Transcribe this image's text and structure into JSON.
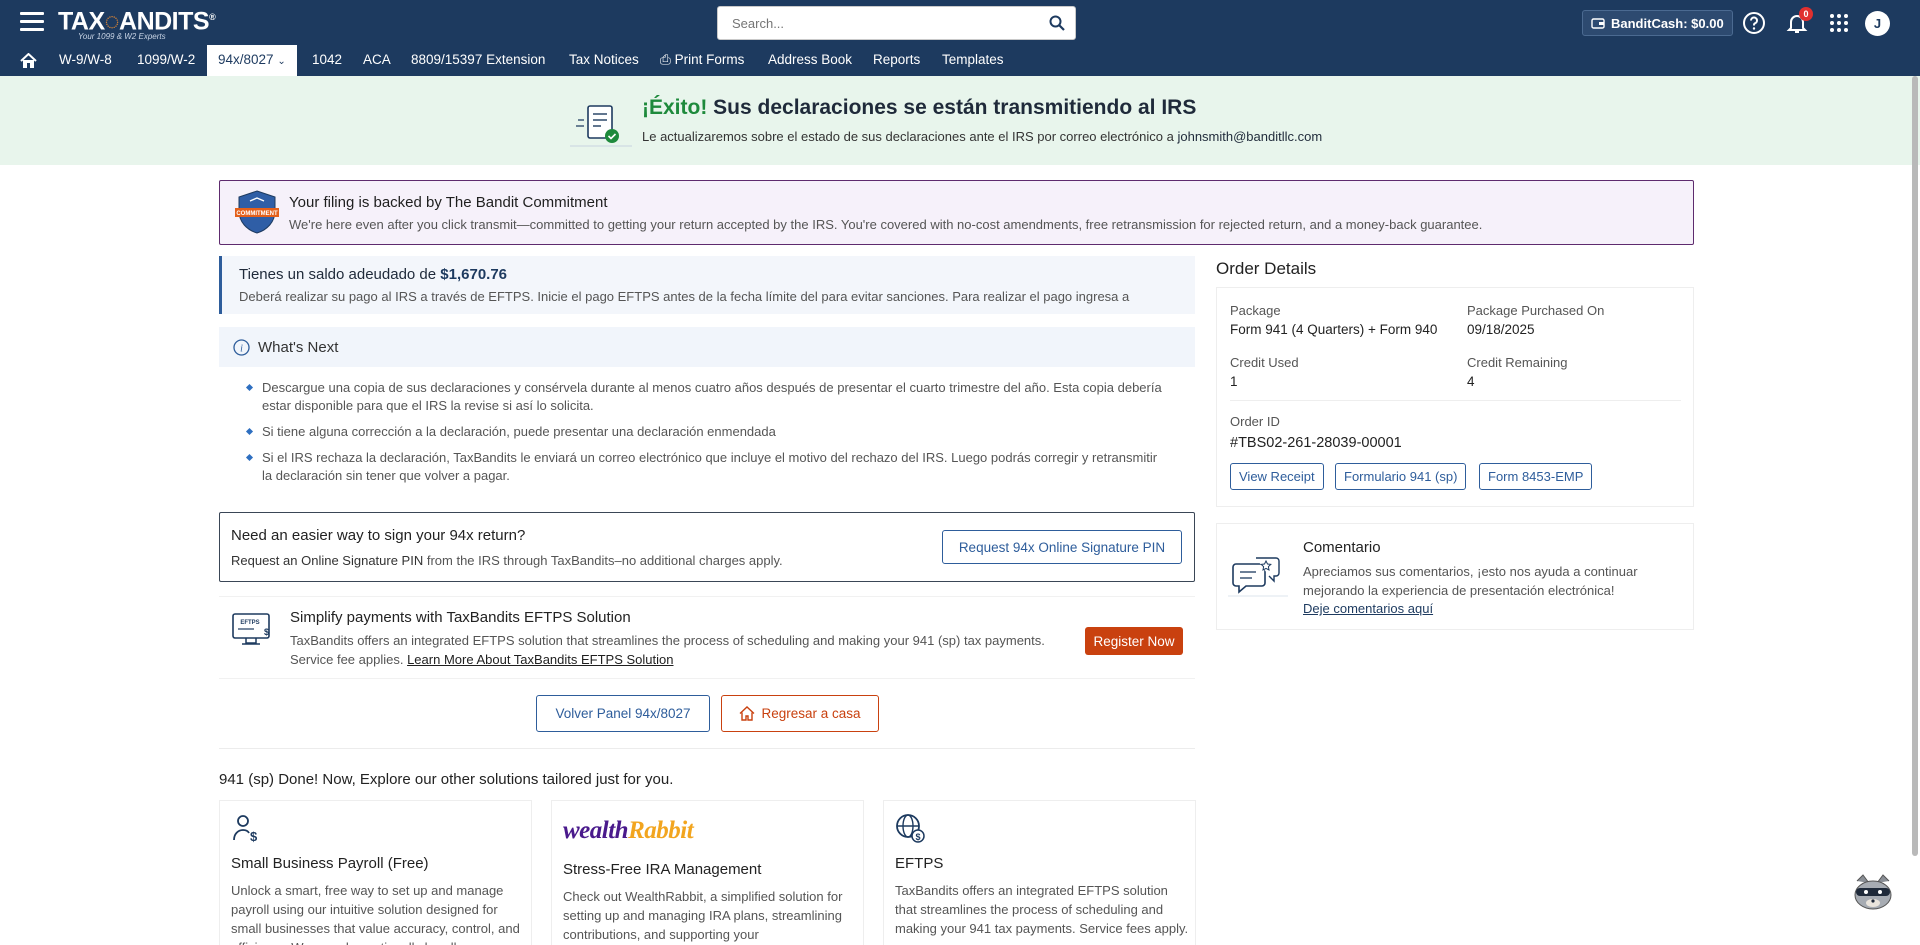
{
  "header": {
    "logo_text_left": "TAX",
    "logo_text_right": "ANDITS",
    "logo_registered": "®",
    "logo_tagline": "Your 1099 & W2 Experts",
    "search_placeholder": "Search...",
    "bandit_cash_label": "BanditCash: $0.00",
    "notifications_count": "0",
    "avatar_initial": "J"
  },
  "nav": {
    "items": [
      {
        "label": "W-9/W-8"
      },
      {
        "label": "1099/W-2"
      },
      {
        "label": "94x/8027"
      },
      {
        "label": "1042"
      },
      {
        "label": "ACA"
      },
      {
        "label": "8809/15397 Extension"
      },
      {
        "label": "Tax Notices"
      },
      {
        "label": "Print Forms"
      },
      {
        "label": "Address Book"
      },
      {
        "label": "Reports"
      },
      {
        "label": "Templates"
      }
    ],
    "active": "94x/8027"
  },
  "success": {
    "title_highlight": "¡Éxito!",
    "title_rest": " Sus declaraciones se están transmitiendo al IRS",
    "subtitle": "Le actualizaremos sobre el estado de sus declaraciones ante el IRS por correo electrónico a ",
    "email": "johnsmith@banditllc.com"
  },
  "commitment": {
    "badge_text": "COMMITMENT",
    "title": "Your filing is backed by The Bandit Commitment",
    "text": "We're here even after you click transmit—committed to getting your return accepted by the IRS. You're covered with no-cost amendments, free retransmission for rejected return, and a money-back guarantee."
  },
  "balance": {
    "title_prefix": "Tienes un saldo adeudado de ",
    "amount": "$1,670.76",
    "text": "Deberá realizar su pago al IRS a través de EFTPS. Inicie el pago EFTPS antes de la fecha límite del para evitar sanciones. Para realizar el pago ingresa a"
  },
  "whats_next": {
    "title": "What's Next",
    "items": [
      "Descargue una copia de sus declaraciones y consérvela durante al menos cuatro años después de presentar el cuarto trimestre del año. Esta copia debería estar disponible para que el IRS la revise si así lo solicita.",
      "Si tiene alguna corrección a la declaración, puede presentar una declaración enmendada",
      "Si el IRS rechaza la declaración, TaxBandits le enviará un correo electrónico que incluye el motivo del rechazo del IRS. Luego podrás corregir y retransmitir la declaración sin tener que volver a pagar."
    ]
  },
  "signature": {
    "title": "Need an easier way to sign your 94x return?",
    "text_dark": "Request an Online Signature PIN",
    "text_rest": " from the IRS through TaxBandits–no additional charges apply.",
    "button": "Request 94x Online Signature PIN"
  },
  "eftps": {
    "icon_text": "EFTPS",
    "title": "Simplify payments with TaxBandits EFTPS Solution",
    "line1": "TaxBandits offers an integrated EFTPS solution that streamlines the process of scheduling and making your 941 (sp) tax payments.",
    "line2": "Service fee applies. ",
    "link": "Learn More About TaxBandits EFTPS Solution",
    "button": "Register Now"
  },
  "actions": {
    "back": "Volver Panel 94x/8027",
    "home": "Regresar a casa"
  },
  "explore": {
    "title": "941 (sp) Done! Now, Explore our other solutions tailored just for you.",
    "cards": [
      {
        "title": "Small Business Payroll (Free)",
        "text": "Unlock a smart, free way to set up and manage payroll using our intuitive solution designed for small businesses that value accuracy, control, and efficiency. We can also optionally handle"
      },
      {
        "logo_left": "wealth",
        "logo_right": "Rabbit",
        "title": "Stress-Free IRA Management",
        "text": "Check out  WealthRabbit, a simplified solution for setting up and managing IRA plans, streamlining contributions, and supporting your"
      },
      {
        "title": "EFTPS",
        "text": "TaxBandits offers an integrated EFTPS solution that streamlines the process of scheduling and making your 941 tax payments. Service fees apply."
      }
    ]
  },
  "order": {
    "title": "Order Details",
    "package_label": "Package",
    "package_value": "Form 941 (4 Quarters) + Form 940",
    "purchased_label": "Package Purchased On",
    "purchased_value": "09/18/2025",
    "credit_used_label": "Credit Used",
    "credit_used_value": "1",
    "credit_remaining_label": "Credit Remaining",
    "credit_remaining_value": "4",
    "order_id_label": "Order ID",
    "order_id_value": "#TBS02-261-28039-00001",
    "buttons": [
      "View Receipt",
      "Formulario 941 (sp)",
      "Form 8453-EMP"
    ]
  },
  "comment": {
    "title": "Comentario",
    "text": "Apreciamos sus comentarios, ¡esto nos ayuda a continuar mejorando la experiencia de presentación electrónica!",
    "link": "Deje comentarios aquí"
  },
  "colors": {
    "header_bg": "#1d3a5f",
    "success_bg": "#e8f5ec",
    "success_green": "#1e8a3c",
    "accent_orange": "#c9410f",
    "link_blue": "#2e5d9b",
    "commitment_border": "#5e2b6e"
  }
}
